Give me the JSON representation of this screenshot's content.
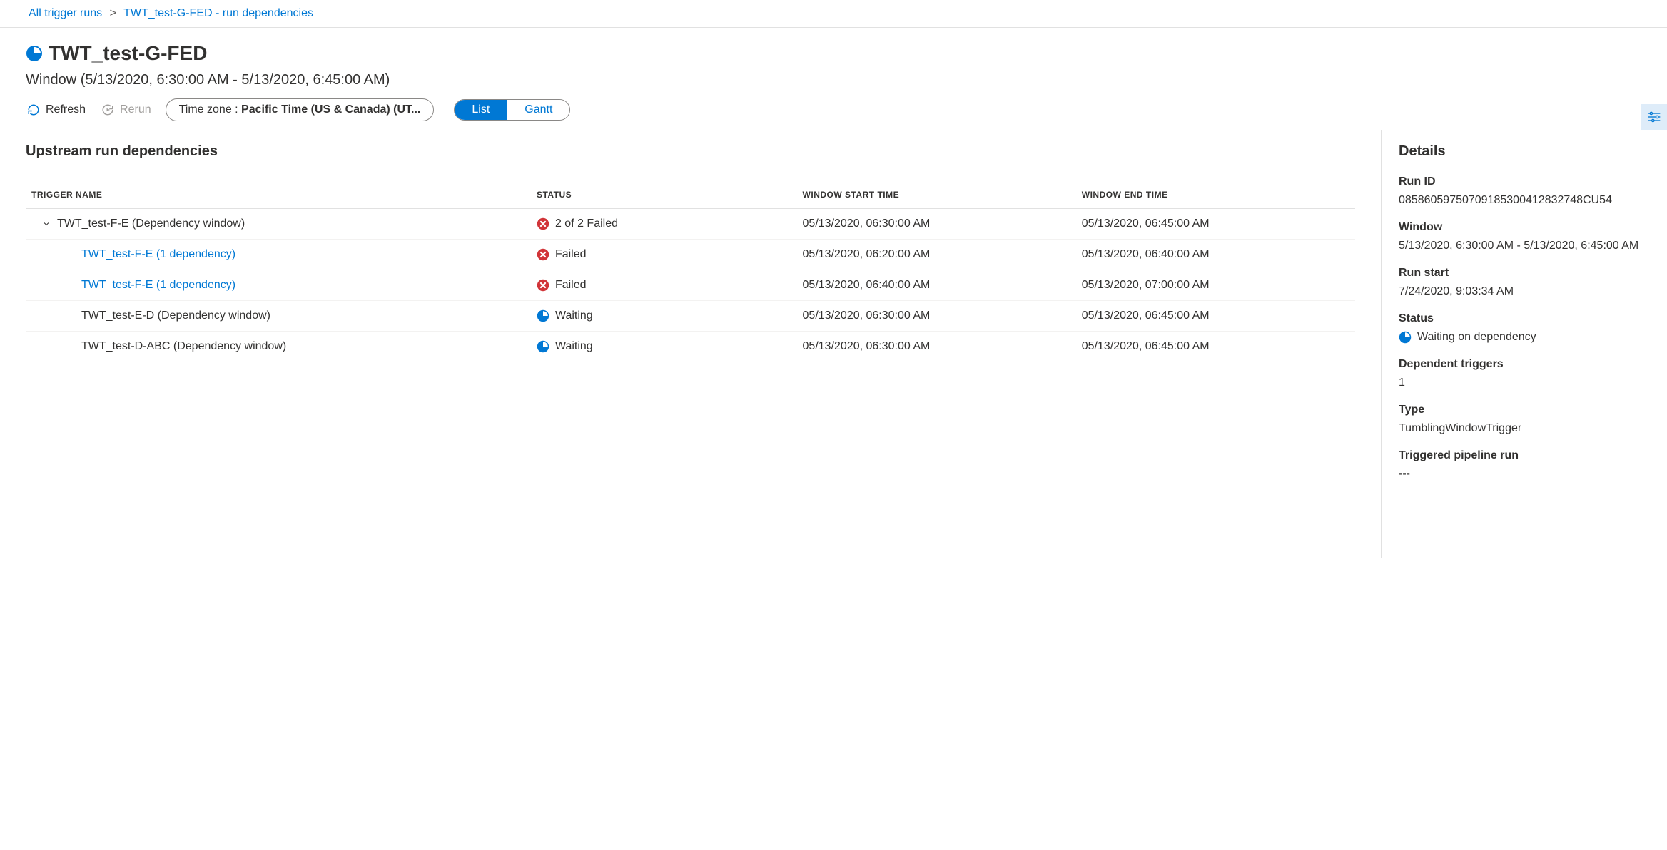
{
  "breadcrumb": {
    "root": "All trigger runs",
    "current": "TWT_test-G-FED - run dependencies"
  },
  "header": {
    "title": "TWT_test-G-FED",
    "window": "Window (5/13/2020, 6:30:00 AM - 5/13/2020, 6:45:00 AM)"
  },
  "toolbar": {
    "refresh": "Refresh",
    "rerun": "Rerun",
    "timezone_label": "Time zone : ",
    "timezone_value": "Pacific Time (US & Canada) (UT...",
    "list": "List",
    "gantt": "Gantt"
  },
  "section_title": "Upstream run dependencies",
  "columns": {
    "trigger_name": "TRIGGER NAME",
    "status": "STATUS",
    "window_start": "WINDOW START TIME",
    "window_end": "WINDOW END TIME"
  },
  "rows": [
    {
      "indent": 0,
      "expandable": true,
      "link": false,
      "name": "TWT_test-F-E (Dependency window)",
      "status_icon": "failed",
      "status_text": "2 of 2 Failed",
      "start": "05/13/2020, 06:30:00 AM",
      "end": "05/13/2020, 06:45:00 AM"
    },
    {
      "indent": 1,
      "expandable": false,
      "link": true,
      "name": "TWT_test-F-E (1 dependency)",
      "status_icon": "failed",
      "status_text": "Failed",
      "start": "05/13/2020, 06:20:00 AM",
      "end": "05/13/2020, 06:40:00 AM"
    },
    {
      "indent": 1,
      "expandable": false,
      "link": true,
      "name": "TWT_test-F-E (1 dependency)",
      "status_icon": "failed",
      "status_text": "Failed",
      "start": "05/13/2020, 06:40:00 AM",
      "end": "05/13/2020, 07:00:00 AM"
    },
    {
      "indent": 1,
      "expandable": false,
      "link": false,
      "name": "TWT_test-E-D (Dependency window)",
      "status_icon": "waiting",
      "status_text": "Waiting",
      "start": "05/13/2020, 06:30:00 AM",
      "end": "05/13/2020, 06:45:00 AM"
    },
    {
      "indent": 1,
      "expandable": false,
      "link": false,
      "name": "TWT_test-D-ABC (Dependency window)",
      "status_icon": "waiting",
      "status_text": "Waiting",
      "start": "05/13/2020, 06:30:00 AM",
      "end": "05/13/2020, 06:45:00 AM"
    }
  ],
  "details": {
    "title": "Details",
    "fields": {
      "run_id_label": "Run ID",
      "run_id_value": "08586059750709185300412832748CU54",
      "window_label": "Window",
      "window_value": "5/13/2020, 6:30:00 AM - 5/13/2020, 6:45:00 AM",
      "run_start_label": "Run start",
      "run_start_value": "7/24/2020, 9:03:34 AM",
      "status_label": "Status",
      "status_value": "Waiting on dependency",
      "dep_triggers_label": "Dependent triggers",
      "dep_triggers_value": "1",
      "type_label": "Type",
      "type_value": "TumblingWindowTrigger",
      "triggered_run_label": "Triggered pipeline run",
      "triggered_run_value": "---"
    }
  }
}
